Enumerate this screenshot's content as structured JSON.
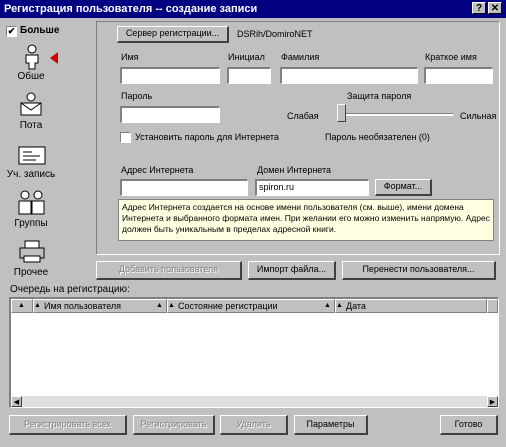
{
  "window": {
    "title": "Регистрация пользователя -- создание записи",
    "help_label": "?",
    "close_label": "✕"
  },
  "sidebar": {
    "more_label": "Больше",
    "more_checked": true,
    "items": [
      {
        "label": "Обше",
        "icon": "person-icon",
        "active": true
      },
      {
        "label": "Пота",
        "icon": "mail-icon",
        "active": false
      },
      {
        "label": "Уч. запись",
        "icon": "id-card-icon",
        "active": false
      },
      {
        "label": "Группы",
        "icon": "group-icon",
        "active": false
      },
      {
        "label": "Прочее",
        "icon": "printer-icon",
        "active": false
      }
    ]
  },
  "form": {
    "server_button": "Сервер регистрации...",
    "server_name": "DSRih/DomiroNET",
    "first_name_label": "Имя",
    "initials_label": "Инициал",
    "last_name_label": "Фамилия",
    "short_name_label": "Краткое имя",
    "first_name_value": "",
    "initials_value": "",
    "last_name_value": "",
    "short_name_value": "",
    "password_label": "Пароль",
    "password_value": "",
    "protection_label": "Защита пароля",
    "weak_label": "Слабая",
    "strong_label": "Сильная",
    "protection_level": 0,
    "internet_password_label": "Установить пароль для Интернета",
    "internet_password_checked": false,
    "password_required_label": "Пароль необязателен (0)",
    "internet_address_label": "Адрес Интернета",
    "internet_address_value": "",
    "internet_domain_label": "Домен Интернета",
    "internet_domain_value": "spiron.ru",
    "format_button": "Формат...",
    "info_text": "Адрес Интернета создается на основе имени пользователя (см. выше), имени домена Интернета и выбранного формата имен. При желании его можно изменить напрямую. Адрес должен быть уникальным в пределах адресной книги."
  },
  "actions": {
    "add_user": "Добавить пользователя",
    "import_file": "Импорт файла...",
    "move_users": "Перенести пользователя..."
  },
  "queue": {
    "label": "Очередь на регистрацию:",
    "columns": [
      "Имя пользователя",
      "Состояние регистрации",
      "Дата"
    ],
    "rows": []
  },
  "footer": {
    "register_all": "Регистрировать всех",
    "register": "Регистрировать",
    "delete": "Удалить",
    "options": "Параметры",
    "done": "Готово"
  },
  "colors": {
    "titlebar": "#000080",
    "face": "#c0c0c0",
    "active_arrow": "#d00000",
    "info_bg": "#ffffe1"
  }
}
